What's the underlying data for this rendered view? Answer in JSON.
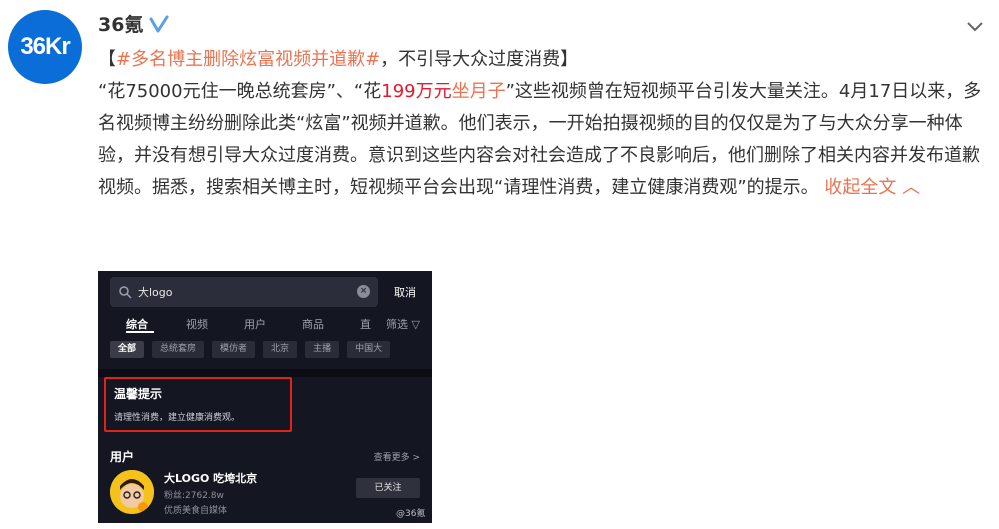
{
  "account": {
    "avatar_text": "36Kr",
    "name": "36氪"
  },
  "post": {
    "bracket_open": "【",
    "hashtag": "#多名博主删除炫富视频并道歉#",
    "title_rest": "，不引导大众过度消费】",
    "p1": "“花75000元住一晚总统套房”、“花",
    "red_amount": "199万元",
    "red_phrase": "坐月子",
    "p2": "”这些视频曾在短视频平台引发大量关注。4月17日以来，多名视频博主纷纷删除此类“炫富”视频并道歉。他们表示，一开始拍摄视频的目的仅仅是为了与大众分享一种体验，并没有想引导大众过度消费。意识到这些内容会对社会造成了不良影响后，他们删除了相关内容并发布道歉视频。据悉，搜索相关博主时，短视频平台会出现“请理性消费，建立健康消费观”的提示。",
    "collapse": "收起全文"
  },
  "screenshot": {
    "search_value": "大logo",
    "cancel": "取消",
    "tabs": [
      "综合",
      "视频",
      "用户",
      "商品",
      "直",
      "筛选"
    ],
    "chips": [
      "全部",
      "总统套房",
      "模仿者",
      "北京",
      "主播",
      "中国大"
    ],
    "tip_title": "温馨提示",
    "tip_text": "请理性消费，建立健康消费观。",
    "users_header": "用户",
    "see_more": "查看更多 >",
    "user_name": "大LOGO 吃垮北京",
    "user_fans": "粉丝:2762.8w",
    "user_desc": "优质美食自媒体",
    "follow_label": "已关注",
    "watermark": "@36氪"
  },
  "icons": [
    "verified-icon",
    "chevron-down-icon",
    "search-icon",
    "clear-icon",
    "filter-icon"
  ],
  "colors": {
    "link": "#eb7350",
    "red": "#e6162d",
    "brand": "#0b6dd8",
    "highlight-box": "#e0241a"
  }
}
